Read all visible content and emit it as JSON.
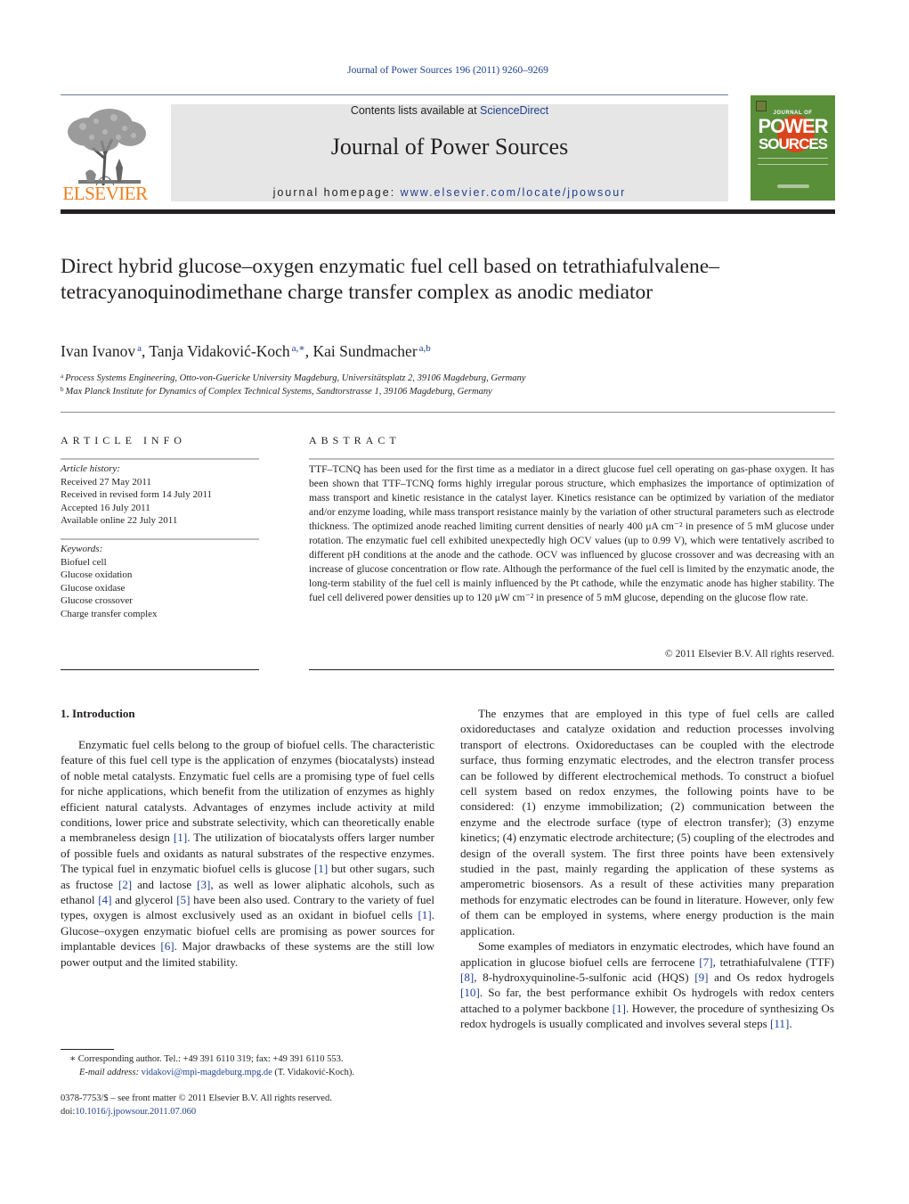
{
  "header": {
    "running_head": "Journal of Power Sources 196 (2011) 9260–9269",
    "publisher_logo_text": "ELSEVIER",
    "contents_prefix": "Contents lists available at ",
    "contents_link": "ScienceDirect",
    "journal_title": "Journal of Power Sources",
    "homepage_prefix": "journal homepage: ",
    "homepage_link": "www.elsevier.com/locate/jpowsour",
    "cover": {
      "small_title": "JOURNAL OF",
      "big_title_1": "POWER",
      "big_title_2": "SOURCES",
      "bg_color": "#5a8f3a",
      "accent_color": "#d9461c"
    }
  },
  "article": {
    "title": "Direct hybrid glucose–oxygen enzymatic fuel cell based on tetrathiafulvalene–tetracyanoquinodimethane charge transfer complex as anodic mediator",
    "authors": [
      {
        "name": "Ivan Ivanov",
        "sup": "a"
      },
      {
        "name": "Tanja Vidaković-Koch",
        "sup": "a,∗"
      },
      {
        "name": "Kai Sundmacher",
        "sup": "a,b"
      }
    ],
    "affiliations": [
      {
        "sup": "a",
        "text": "Process Systems Engineering, Otto-von-Guericke University Magdeburg, Universitätsplatz 2, 39106 Magdeburg, Germany"
      },
      {
        "sup": "b",
        "text": "Max Planck Institute for Dynamics of Complex Technical Systems, Sandtorstrasse 1, 39106 Magdeburg, Germany"
      }
    ]
  },
  "article_info": {
    "heading": "ARTICLE INFO",
    "history_label": "Article history:",
    "history": [
      "Received 27 May 2011",
      "Received in revised form 14 July 2011",
      "Accepted 16 July 2011",
      "Available online 22 July 2011"
    ],
    "keywords_label": "Keywords:",
    "keywords": [
      "Biofuel cell",
      "Glucose oxidation",
      "Glucose oxidase",
      "Glucose crossover",
      "Charge transfer complex"
    ]
  },
  "abstract": {
    "heading": "ABSTRACT",
    "text": "TTF–TCNQ has been used for the first time as a mediator in a direct glucose fuel cell operating on gas-phase oxygen. It has been shown that TTF–TCNQ forms highly irregular porous structure, which emphasizes the importance of optimization of mass transport and kinetic resistance in the catalyst layer. Kinetics resistance can be optimized by variation of the mediator and/or enzyme loading, while mass transport resistance mainly by the variation of other structural parameters such as electrode thickness. The optimized anode reached limiting current densities of nearly 400 μA cm⁻² in presence of 5 mM glucose under rotation. The enzymatic fuel cell exhibited unexpectedly high OCV values (up to 0.99 V), which were tentatively ascribed to different pH conditions at the anode and the cathode. OCV was influenced by glucose crossover and was decreasing with an increase of glucose concentration or flow rate. Although the performance of the fuel cell is limited by the enzymatic anode, the long-term stability of the fuel cell is mainly influenced by the Pt cathode, while the enzymatic anode has higher stability. The fuel cell delivered power densities up to 120 μW cm⁻² in presence of 5 mM glucose, depending on the glucose flow rate.",
    "copyright": "© 2011 Elsevier B.V. All rights reserved."
  },
  "body": {
    "section_heading": "1.  Introduction",
    "left_paragraphs": [
      [
        {
          "t": "Enzymatic fuel cells belong to the group of biofuel cells. The characteristic feature of this fuel cell type is the application of enzymes (biocatalysts) instead of noble metal catalysts. Enzymatic fuel cells are a promising type of fuel cells for niche applications, which benefit from the utilization of enzymes as highly efficient natural catalysts. Advantages of enzymes include activity at mild conditions, lower price and substrate selectivity, which can theoretically enable a membraneless design "
        },
        {
          "ref": "[1]"
        },
        {
          "t": ". The utilization of biocatalysts offers larger number of possible fuels and oxidants as natural substrates of the respective enzymes. The typical fuel in enzymatic biofuel cells is glucose "
        },
        {
          "ref": "[1]"
        },
        {
          "t": " but other sugars, such as fructose "
        },
        {
          "ref": "[2]"
        },
        {
          "t": " and lactose "
        },
        {
          "ref": "[3]"
        },
        {
          "t": ", as well as lower aliphatic alcohols, such as ethanol "
        },
        {
          "ref": "[4]"
        },
        {
          "t": " and glycerol "
        },
        {
          "ref": "[5]"
        },
        {
          "t": " have been also used. Contrary to the variety of fuel types, oxygen is almost exclusively used as an oxidant in biofuel cells "
        },
        {
          "ref": "[1]"
        },
        {
          "t": ". Glucose–oxygen enzymatic biofuel cells are promising as power sources for implantable devices "
        },
        {
          "ref": "[6]"
        },
        {
          "t": ". Major drawbacks of these systems are the still low power output and the limited stability."
        }
      ]
    ],
    "right_paragraphs": [
      [
        {
          "t": "The enzymes that are employed in this type of fuel cells are called oxidoreductases and catalyze oxidation and reduction processes involving transport of electrons. Oxidoreductases can be coupled with the electrode surface, thus forming enzymatic electrodes, and the electron transfer process can be followed by different electrochemical methods. To construct a biofuel cell system based on redox enzymes, the following points have to be considered: (1) enzyme immobilization; (2) communication between the enzyme and the electrode surface (type of electron transfer); (3) enzyme kinetics; (4) enzymatic electrode architecture; (5) coupling of the electrodes and design of the overall system. The first three points have been extensively studied in the past, mainly regarding the application of these systems as amperometric biosensors. As a result of these activities many preparation methods for enzymatic electrodes can be found in literature. However, only few of them can be employed in systems, where energy production is the main application."
        }
      ],
      [
        {
          "t": "Some examples of mediators in enzymatic electrodes, which have found an application in glucose biofuel cells are ferrocene "
        },
        {
          "ref": "[7]"
        },
        {
          "t": ", tetrathiafulvalene (TTF) "
        },
        {
          "ref": "[8]"
        },
        {
          "t": ", 8-hydroxyquinoline-5-sulfonic acid (HQS) "
        },
        {
          "ref": "[9]"
        },
        {
          "t": " and Os redox hydrogels "
        },
        {
          "ref": "[10]"
        },
        {
          "t": ". So far, the best performance exhibit Os hydrogels with redox centers attached to a polymer backbone "
        },
        {
          "ref": "[1]"
        },
        {
          "t": ". However, the procedure of synthesizing Os redox hydrogels is usually complicated and involves several steps "
        },
        {
          "ref": "[11]"
        },
        {
          "t": "."
        }
      ]
    ]
  },
  "footnotes": {
    "corresponding": "∗  Corresponding author. Tel.: +49 391 6110 319; fax: +49 391 6110 553.",
    "email_label": "E-mail address:",
    "email": "vidakovi@mpi-magdeburg.mpg.de",
    "email_suffix": " (T. Vidaković-Koch).",
    "issn_line": "0378-7753/$ – see front matter © 2011 Elsevier B.V. All rights reserved.",
    "doi_prefix": "doi:",
    "doi": "10.1016/j.jpowsour.2011.07.060"
  },
  "colors": {
    "link": "#1f3f8f",
    "elsevier_orange": "#f07e1e",
    "banner_grey": "#e6e6e6"
  }
}
